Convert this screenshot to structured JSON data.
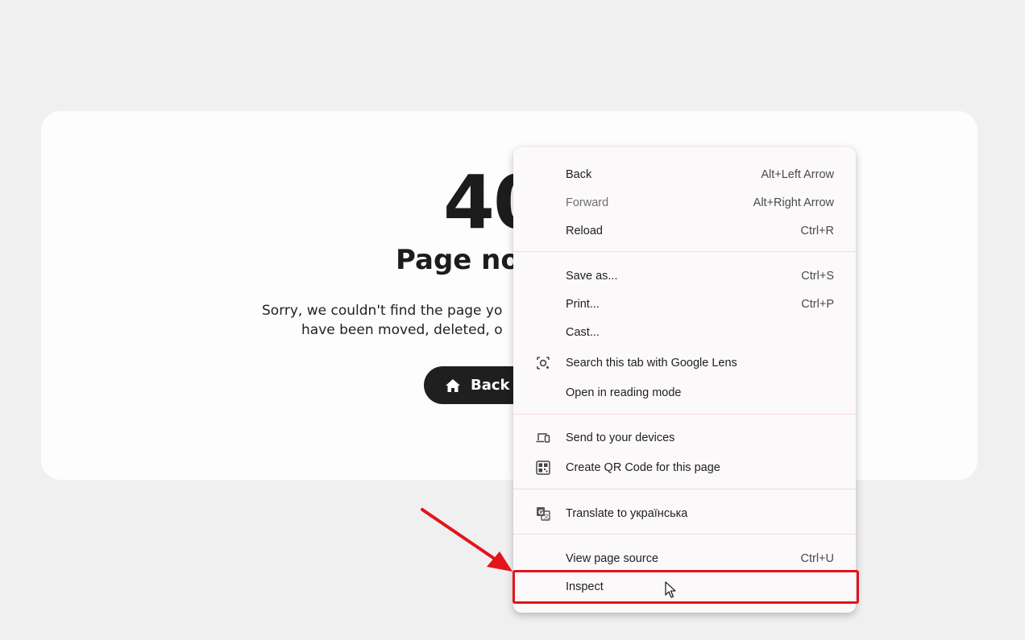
{
  "page": {
    "error_code": "40",
    "title": "Page no",
    "message_line1": "Sorry, we couldn't find the page yo",
    "message_line2": "have been moved, deleted, o",
    "back_button_label": "Back t"
  },
  "context_menu": {
    "items": [
      {
        "label": "Back",
        "shortcut": "Alt+Left Arrow"
      },
      {
        "label": "Forward",
        "shortcut": "Alt+Right Arrow",
        "disabled": true
      },
      {
        "label": "Reload",
        "shortcut": "Ctrl+R"
      },
      {
        "label": "Save as...",
        "shortcut": "Ctrl+S"
      },
      {
        "label": "Print...",
        "shortcut": "Ctrl+P"
      },
      {
        "label": "Cast...",
        "shortcut": ""
      },
      {
        "label": "Search this tab with Google Lens",
        "shortcut": "",
        "icon": "google-lens-icon"
      },
      {
        "label": "Open in reading mode",
        "shortcut": ""
      },
      {
        "label": "Send to your devices",
        "shortcut": "",
        "icon": "devices-icon"
      },
      {
        "label": "Create QR Code for this page",
        "shortcut": "",
        "icon": "qr-code-icon"
      },
      {
        "label": "Translate to українська",
        "shortcut": "",
        "icon": "translate-icon"
      },
      {
        "label": "View page source",
        "shortcut": "Ctrl+U"
      },
      {
        "label": "Inspect",
        "shortcut": ""
      }
    ]
  },
  "annotation": {
    "highlight_color": "#e3141b",
    "highlighted_item": "Inspect"
  }
}
